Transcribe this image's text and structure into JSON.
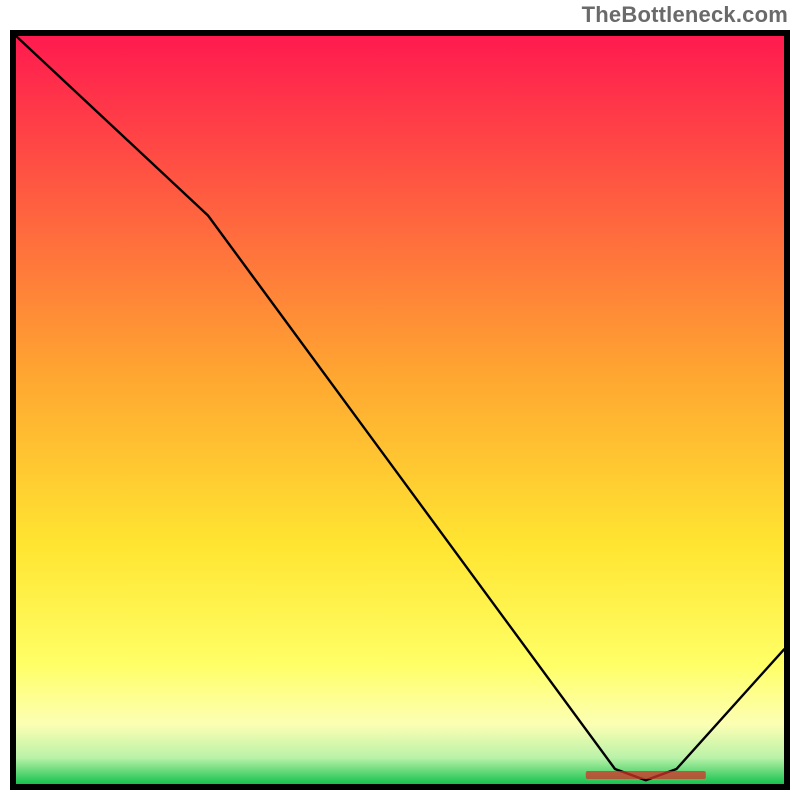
{
  "attribution": "TheBottleneck.com",
  "chart_data": {
    "type": "line",
    "title": "",
    "xlabel": "",
    "ylabel": "",
    "x_range": [
      0,
      100
    ],
    "y_range": [
      0,
      100
    ],
    "background_gradient": {
      "direction": "vertical",
      "stops": [
        {
          "pos": 0.0,
          "color": "#ff1a4f"
        },
        {
          "pos": 0.45,
          "color": "#ffa531"
        },
        {
          "pos": 0.68,
          "color": "#ffe531"
        },
        {
          "pos": 0.84,
          "color": "#ffff66"
        },
        {
          "pos": 0.92,
          "color": "#fcffb3"
        },
        {
          "pos": 0.965,
          "color": "#b9f2a8"
        },
        {
          "pos": 1.0,
          "color": "#17c24f"
        }
      ]
    },
    "series": [
      {
        "name": "bottleneck-curve",
        "x": [
          0,
          25,
          78,
          82,
          86,
          100
        ],
        "y": [
          100,
          76,
          2,
          0.5,
          2,
          18
        ]
      }
    ],
    "annotations": [
      {
        "name": "min-marker",
        "text_color": "#d4322a",
        "approx_x": 82,
        "approx_y": 1.2
      }
    ]
  }
}
